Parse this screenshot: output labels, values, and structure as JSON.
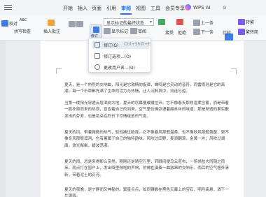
{
  "menubar": {
    "tabs": [
      "开始",
      "插入",
      "页面",
      "引用",
      "审阅",
      "视图",
      "工具",
      "会员专享"
    ],
    "active_tab": "审阅",
    "wps_ai": "WPS AI",
    "right_icon": "⊙"
  },
  "toolbar": {
    "left_label": "校对",
    "spell": "ABC",
    "spell_label": "拼写检查",
    "insert_comment": "插入批注",
    "revise": "修订",
    "show_markup": "显示标记",
    "review": "审阅",
    "markup_mode": "显示标记的最终状态",
    "accept": "接受",
    "reject": "拒绝",
    "previous": "上一条",
    "next": "下一条",
    "compare": "比较",
    "restrict": "限制",
    "document_permission": "文档权限",
    "edit": "编辑",
    "word_count": "转繁",
    "simplify": "繁转简"
  },
  "popup": {
    "items": [
      {
        "label": "修订(G)",
        "shortcut": "Ctrl+Shift+E"
      },
      {
        "label": "修订选项...(O)",
        "shortcut": ""
      },
      {
        "label": "更改用户名...(U)",
        "shortcut": ""
      }
    ]
  },
  "document": {
    "paragraphs": [
      "夏天，是一个热烈的交响曲，阳光是它激情的旋律，蝉鸣是它灵动的音符，而雷雨则是它的高潮，每一个乐章都充满了生命的活力与热情，让人沉醉其中，流连忘返。",
      "当第一缕阳光穿透云层洒向大地，夏天的序幕便缓缓拉开。它不像春天那样温柔含蓄，而是带着一股扑面而来的热浪，宣告着自己的到来。空气里仿佛弥漫着甜丝丝的味道，那是熟透的果实散发出的芬芳，也是花朵在烈日下尽情绽放的气息。",
      "夏天的风，带着微微的热气，轻轻拂过脸庞。它不像春风那般温柔，也不像秋风那般萧瑟，更不像冬风那般凛冽，它有着属于自己的独特韵味。风吹过田野，麦浪翻滚，金黄一片；风吹过湖面，波光粼粼，碧波荡漾。",
      "夏天的雨，总是来得那么突然。刚刚还是晴空万里，转眼间便乌云密布，一场倾盆大雨随之而来。雨点打在窗户上，发出噼里啪啦的声响，仿佛在演奏一曲激昂的交响乐。雨后的空气格外清新，带着泥土的芬芳。",
      "夏天的夜晚，是宁静而又神秘的。繁星点点，如同镶嵌在黑色天幕上的宝石，明月高悬，洒下一片银辉。"
    ]
  }
}
